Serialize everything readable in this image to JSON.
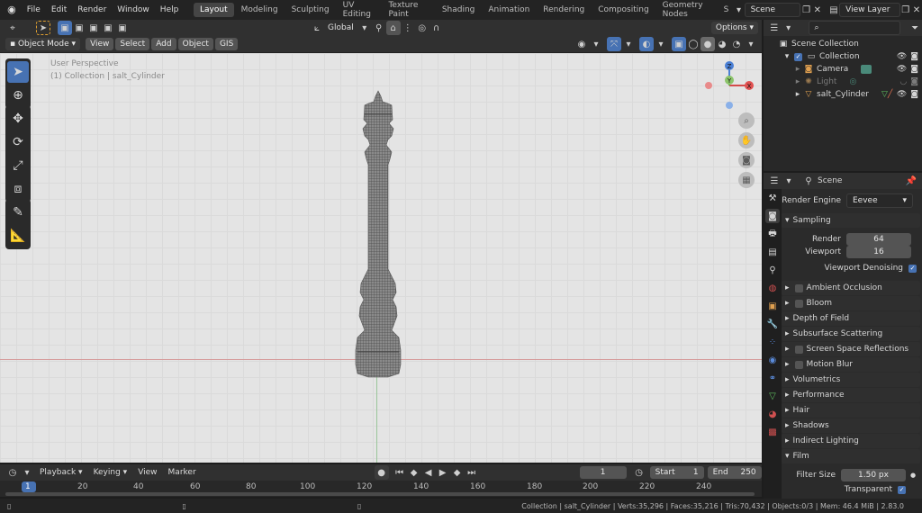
{
  "topbar": {
    "menus": [
      "File",
      "Edit",
      "Render",
      "Window",
      "Help"
    ],
    "workspaces": [
      "Layout",
      "Modeling",
      "Sculpting",
      "UV Editing",
      "Texture Paint",
      "Shading",
      "Animation",
      "Rendering",
      "Compositing",
      "Geometry Nodes",
      "S"
    ],
    "active_workspace": "Layout",
    "scene": "Scene",
    "view_layer": "View Layer"
  },
  "viewport_header": {
    "transform_orientation": "Global",
    "options_label": "Options",
    "mode": "Object Mode",
    "menus": [
      "View",
      "Select",
      "Add",
      "Object",
      "GIS"
    ]
  },
  "viewport": {
    "perspective": "User Perspective",
    "collection_info": "(1) Collection | salt_Cylinder",
    "gizmo": {
      "x": "X",
      "y": "Y",
      "z": "Z"
    }
  },
  "outliner": {
    "items": [
      {
        "label": "Scene Collection",
        "icon": "scene-collection-icon"
      },
      {
        "label": "Collection",
        "icon": "collection-icon"
      },
      {
        "label": "Camera",
        "icon": "camera-icon"
      },
      {
        "label": "Light",
        "icon": "light-icon"
      },
      {
        "label": "salt_Cylinder",
        "icon": "mesh-icon"
      }
    ]
  },
  "properties": {
    "header": "Scene",
    "render_engine_label": "Render Engine",
    "render_engine": "Eevee",
    "sampling": {
      "title": "Sampling",
      "render_label": "Render",
      "render_value": "64",
      "viewport_label": "Viewport",
      "viewport_value": "16",
      "denoising_label": "Viewport Denoising"
    },
    "panels": [
      "Ambient Occlusion",
      "Bloom",
      "Depth of Field",
      "Subsurface Scattering",
      "Screen Space Reflections",
      "Motion Blur",
      "Volumetrics",
      "Performance",
      "Hair",
      "Shadows",
      "Indirect Lighting",
      "Film"
    ],
    "film": {
      "filter_size_label": "Filter Size",
      "filter_size_value": "1.50 px",
      "transparent_label": "Transparent"
    }
  },
  "timeline": {
    "menus": [
      "Playback",
      "Keying",
      "View",
      "Marker"
    ],
    "current_frame": "1",
    "start_label": "Start",
    "start_value": "1",
    "end_label": "End",
    "end_value": "250",
    "ticks": [
      "1",
      "20",
      "40",
      "60",
      "80",
      "100",
      "120",
      "140",
      "160",
      "180",
      "200",
      "220",
      "240"
    ]
  },
  "statusbar": {
    "text": "Collection | salt_Cylinder | Verts:35,296 | Faces:35,216 | Tris:70,432 | Objects:0/3 | Mem: 46.4 MiB | 2.83.0"
  },
  "colors": {
    "accent": "#4772b3",
    "background": "#e4e4e4",
    "header": "#303030"
  }
}
